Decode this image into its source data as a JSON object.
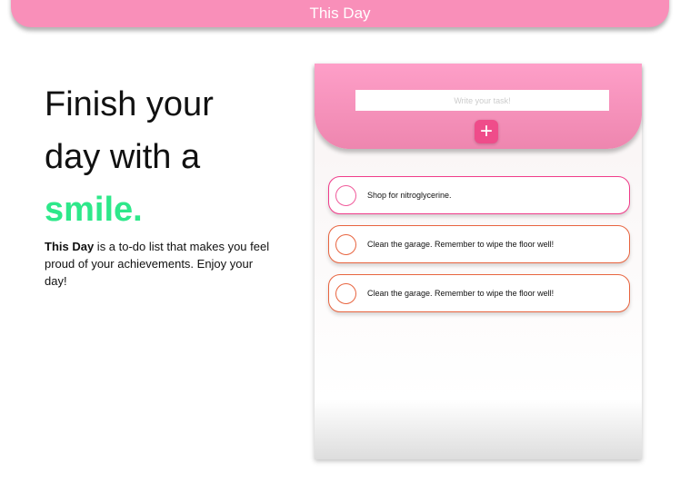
{
  "header": {
    "title": "This Day"
  },
  "hero": {
    "line1": "Finish your",
    "line2": "day with a",
    "highlight": "smile.",
    "brand": "This Day",
    "description": " is a to-do list that makes you feel proud of your achievements. Enjoy your day!"
  },
  "app": {
    "input_placeholder": "Write your task!",
    "add_label": "+",
    "tasks": [
      "Shop for nitroglycerine.",
      "Clean the garage. Remember to wipe the floor well!",
      "Clean the garage. Remember to wipe the floor well!"
    ]
  }
}
